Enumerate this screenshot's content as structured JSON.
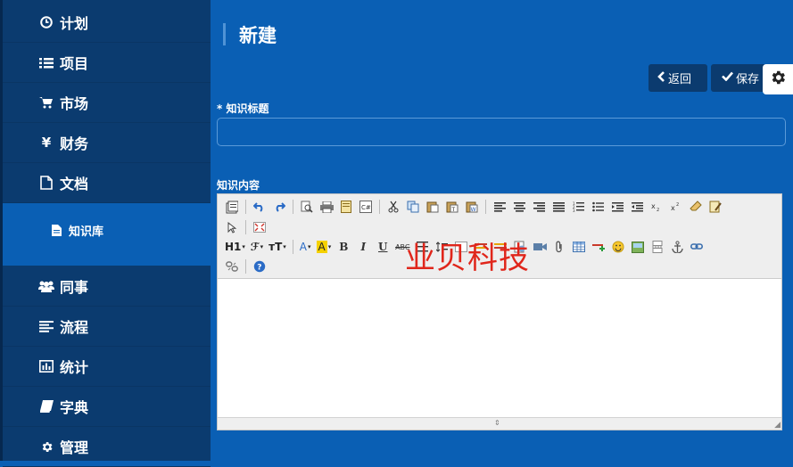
{
  "sidebar": {
    "items": [
      {
        "label": "计划",
        "icon": "clock-icon"
      },
      {
        "label": "项目",
        "icon": "list-icon"
      },
      {
        "label": "市场",
        "icon": "cart-icon"
      },
      {
        "label": "财务",
        "icon": "yen-icon"
      },
      {
        "label": "文档",
        "icon": "file-icon"
      },
      {
        "label": "同事",
        "icon": "users-icon"
      },
      {
        "label": "流程",
        "icon": "align-left-icon"
      },
      {
        "label": "统计",
        "icon": "bar-chart-icon"
      },
      {
        "label": "字典",
        "icon": "book-icon"
      },
      {
        "label": "管理",
        "icon": "gear-icon"
      }
    ],
    "sub_item": {
      "label": "知识库",
      "icon": "file-text-icon"
    },
    "yen_glyph": "¥"
  },
  "header": {
    "title": "新建"
  },
  "actions": {
    "back_label": "返回",
    "save_label": "保存"
  },
  "form": {
    "title_label": "* 知识标题",
    "title_value": "",
    "content_label": "知识内容"
  },
  "editor": {
    "toolbar_row2_text": {
      "heading": "H1",
      "font_family": "ℱ",
      "font_size": "тT",
      "font_color": "A",
      "bg_color": "A",
      "bold": "B",
      "italic": "I",
      "underline": "U",
      "strike": "ABC"
    },
    "watermark": "业贝科技"
  },
  "colors": {
    "sidebar": "#0b3b6f",
    "main_bg": "#0a5fb4",
    "button": "#0b3b6f",
    "watermark": "#e0261b"
  }
}
